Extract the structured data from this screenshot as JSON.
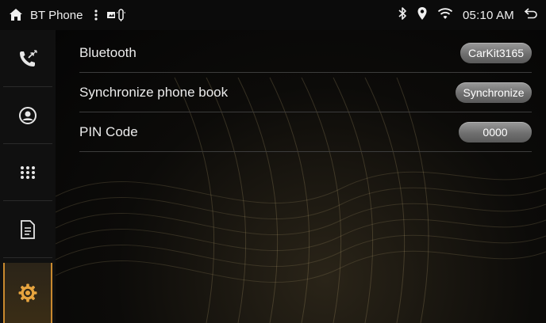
{
  "statusbar": {
    "title": "BT Phone",
    "time": "05:10 AM",
    "icons": [
      "home-icon",
      "menu-dots-icon",
      "media-icon",
      "bluetooth-icon",
      "location-icon",
      "wifi-icon",
      "back-icon"
    ]
  },
  "sidebar": {
    "items": [
      {
        "name": "call-log",
        "icon": "call-arrows-icon",
        "active": false
      },
      {
        "name": "contacts",
        "icon": "contact-icon",
        "active": false
      },
      {
        "name": "dialpad",
        "icon": "dialpad-icon",
        "active": false
      },
      {
        "name": "sms",
        "icon": "document-icon",
        "active": false
      },
      {
        "name": "settings",
        "icon": "gear-icon",
        "active": true
      }
    ]
  },
  "settings": {
    "rows": [
      {
        "label": "Bluetooth",
        "value": "CarKit3165"
      },
      {
        "label": "Synchronize phone book",
        "value": "Synchronize"
      },
      {
        "label": "PIN Code",
        "value": "0000"
      }
    ]
  },
  "colors": {
    "accent": "#c9892e",
    "background": "#000000",
    "pill": "#7a7a7a"
  }
}
